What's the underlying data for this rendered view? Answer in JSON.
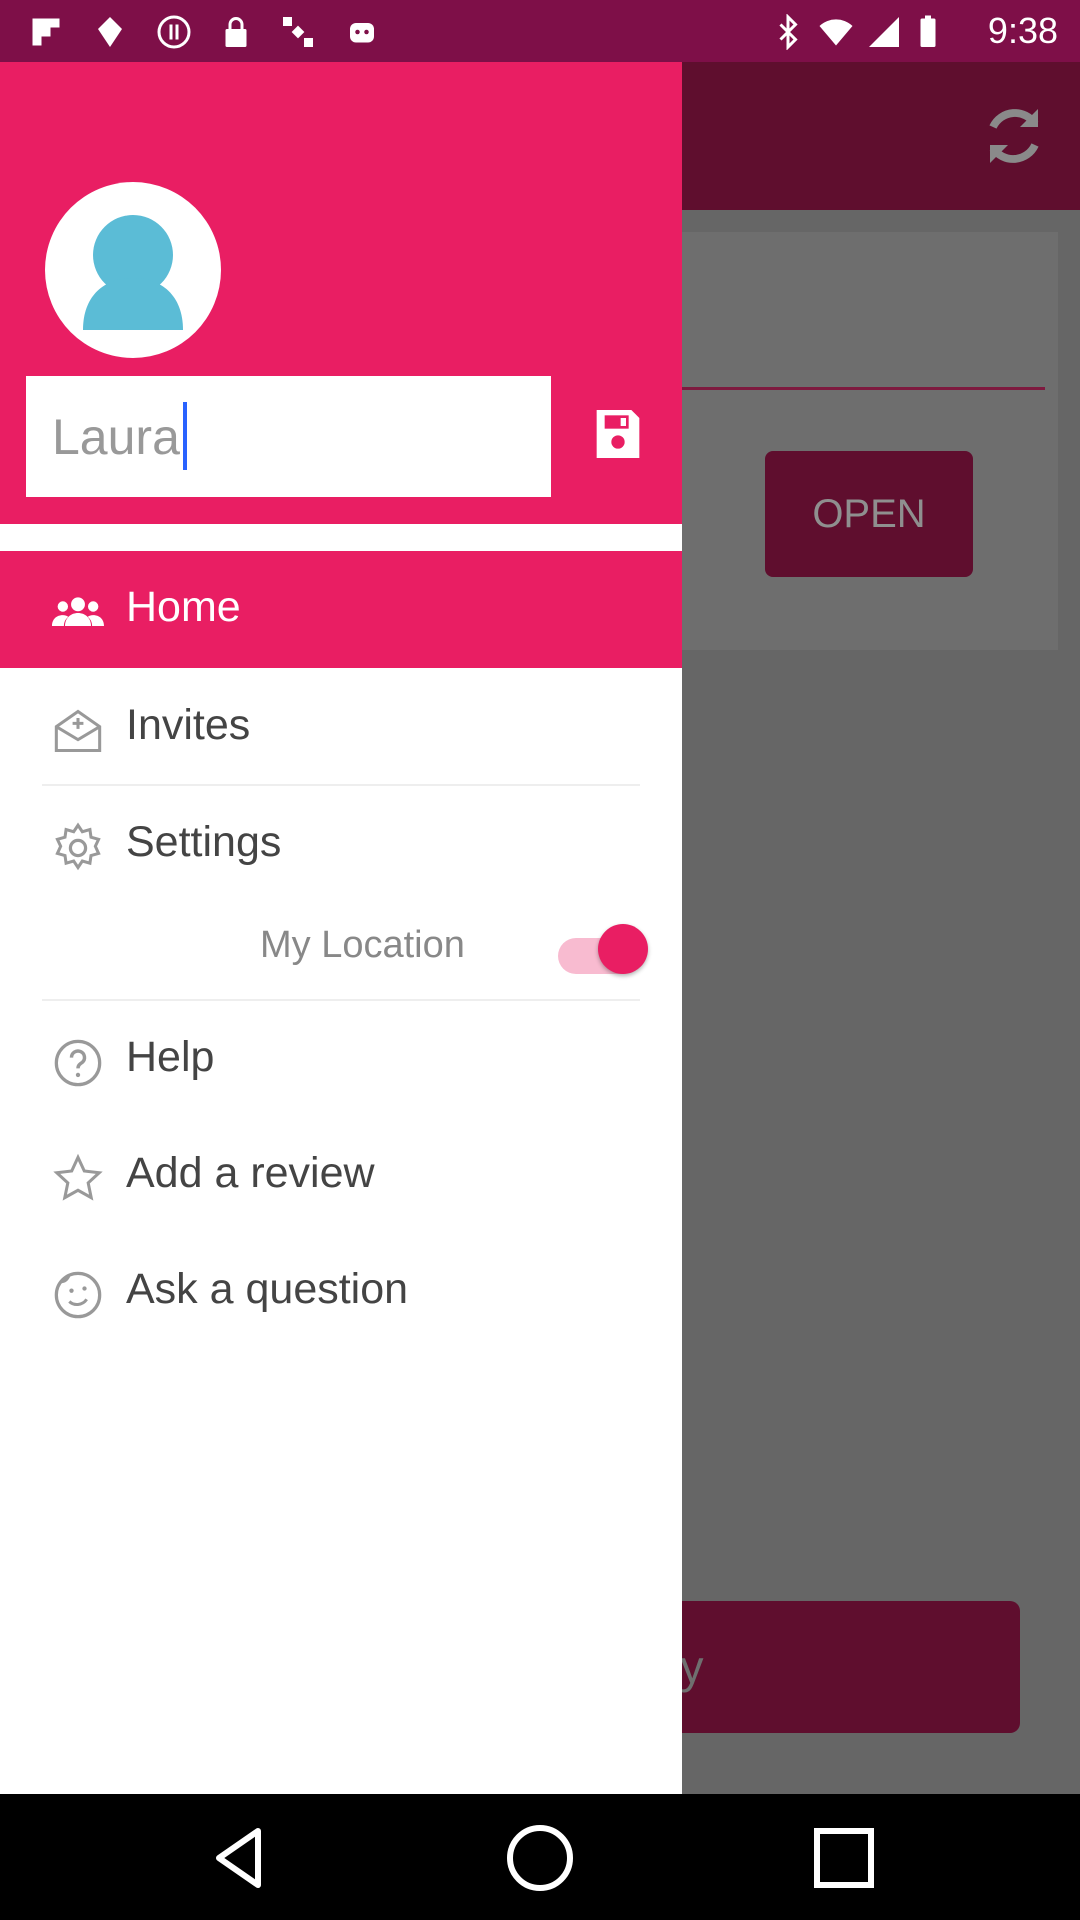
{
  "status_bar": {
    "time": "9:38",
    "left_icons": [
      "flipboard-icon",
      "maps-icon",
      "media-pause-icon",
      "lock-icon",
      "satellite-icon",
      "android-icon"
    ],
    "right_icons": [
      "bluetooth-icon",
      "wifi-icon",
      "signal-icon",
      "battery-icon"
    ]
  },
  "background_app": {
    "open_button": "OPEN",
    "bottom_button_partial": "ily",
    "refresh_icon": "refresh-icon"
  },
  "drawer": {
    "name_input": {
      "value": "Laura"
    },
    "menu": {
      "home": "Home",
      "invites": "Invites",
      "settings": "Settings",
      "my_location": "My Location",
      "help": "Help",
      "add_review": "Add a review",
      "ask_question": "Ask a question"
    },
    "my_location_enabled": true
  },
  "colors": {
    "accent": "#e91e63",
    "status_bar": "#7e0f48",
    "dimmed_app_bar": "#5f0e2e"
  }
}
